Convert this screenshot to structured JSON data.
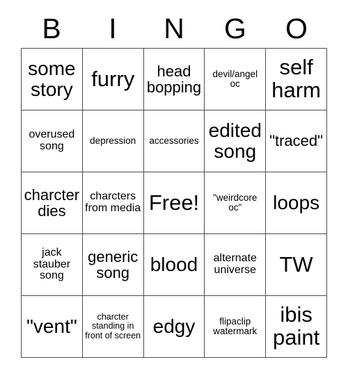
{
  "card": {
    "header_letters": [
      "B",
      "I",
      "N",
      "G",
      "O"
    ],
    "rows": [
      [
        {
          "text": "some story",
          "size": "fs-lg"
        },
        {
          "text": "furry",
          "size": "fs-xl"
        },
        {
          "text": "head bopping",
          "size": "fs-md"
        },
        {
          "text": "devil/angel oc",
          "size": "fs-xs"
        },
        {
          "text": "self harm",
          "size": "fs-xl"
        }
      ],
      [
        {
          "text": "overused song",
          "size": "fs-sm"
        },
        {
          "text": "depression",
          "size": "fs-xs"
        },
        {
          "text": "accessories",
          "size": "fs-xs"
        },
        {
          "text": "edited song",
          "size": "fs-lg"
        },
        {
          "text": "\"traced\"",
          "size": "fs-md"
        }
      ],
      [
        {
          "text": "charcter dies",
          "size": "fs-md"
        },
        {
          "text": "charcters from media",
          "size": "fs-sm"
        },
        {
          "text": "Free!",
          "size": "fs-xl"
        },
        {
          "text": "\"weirdcore oc\"",
          "size": "fs-xs"
        },
        {
          "text": "loops",
          "size": "fs-lg"
        }
      ],
      [
        {
          "text": "jack stauber song",
          "size": "fs-sm"
        },
        {
          "text": "generic song",
          "size": "fs-md"
        },
        {
          "text": "blood",
          "size": "fs-lg"
        },
        {
          "text": "alternate universe",
          "size": "fs-sm"
        },
        {
          "text": "TW",
          "size": "fs-xl"
        }
      ],
      [
        {
          "text": "\"vent\"",
          "size": "fs-lg"
        },
        {
          "text": "charcter standing in front of screen",
          "size": "fs-xxs"
        },
        {
          "text": "edgy",
          "size": "fs-lg"
        },
        {
          "text": "flipaclip watermark",
          "size": "fs-xs"
        },
        {
          "text": "ibis paint",
          "size": "fs-xl"
        }
      ]
    ]
  }
}
